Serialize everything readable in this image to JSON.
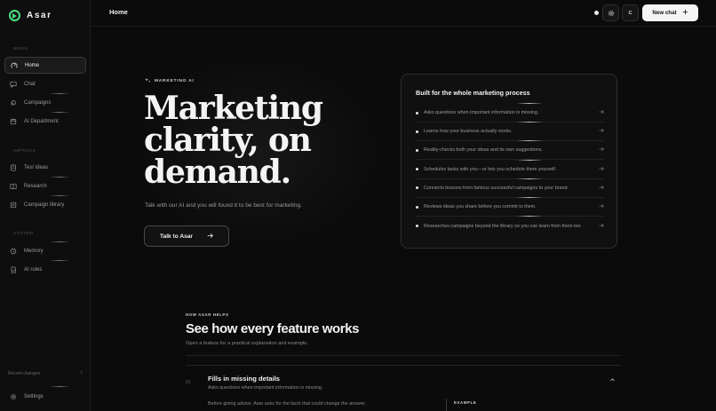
{
  "brand": {
    "name": "Asar"
  },
  "sidebar": {
    "sections": [
      {
        "label": "WORK",
        "items": [
          {
            "label": "Home",
            "icon": "home-icon",
            "active": true
          },
          {
            "label": "Chat",
            "icon": "chat-icon"
          },
          {
            "label": "Campaigns",
            "icon": "rocket-icon"
          },
          {
            "label": "AI Department",
            "icon": "calendar-icon"
          }
        ]
      },
      {
        "label": "IMPROVE",
        "items": [
          {
            "label": "Test ideas",
            "icon": "document-icon"
          },
          {
            "label": "Research",
            "icon": "book-icon"
          },
          {
            "label": "Campaign library",
            "icon": "library-icon"
          }
        ]
      },
      {
        "label": "SYSTEM",
        "items": [
          {
            "label": "Memory",
            "icon": "memory-icon"
          },
          {
            "label": "AI rules",
            "icon": "rules-icon"
          }
        ]
      }
    ],
    "recent_label": "Recent changes",
    "recent_count": "7",
    "settings_label": "Settings"
  },
  "topbar": {
    "title": "Home",
    "avatar_initial": "C",
    "new_chat_label": "New chat"
  },
  "hero": {
    "eyebrow": "MARKETING AI",
    "headline": "Marketing clarity, on demand.",
    "subtitle": "Talk with our AI and you will found it to be best for marketing.",
    "cta_label": "Talk to Asar"
  },
  "feature_card": {
    "title": "Built for the whole marketing process",
    "items": [
      "Asks questions when important information is missing.",
      "Learns how your business actually works.",
      "Reality-checks both your ideas and its own suggestions.",
      "Schedules tasks with you—or lets you schedule them yourself.",
      "Connects lessons from famous successful campaigns to your brand.",
      "Reviews ideas you share before you commit to them.",
      "Researches campaigns beyond the library so you can learn from them too."
    ]
  },
  "how": {
    "eyebrow": "HOW ASAR HELPS",
    "title": "See how every feature works",
    "description": "Open a feature for a practical explanation and example.",
    "feature": {
      "number": "01",
      "title": "Fills in missing details",
      "subtitle": "Asks questions when important information is missing.",
      "body": "Before giving advice, Asar asks for the facts that could change the answer.",
      "example_label": "EXAMPLE"
    }
  },
  "colors": {
    "accent": "#4ade80",
    "background": "#0b0b0b",
    "button_light": "#f5f5f5"
  }
}
